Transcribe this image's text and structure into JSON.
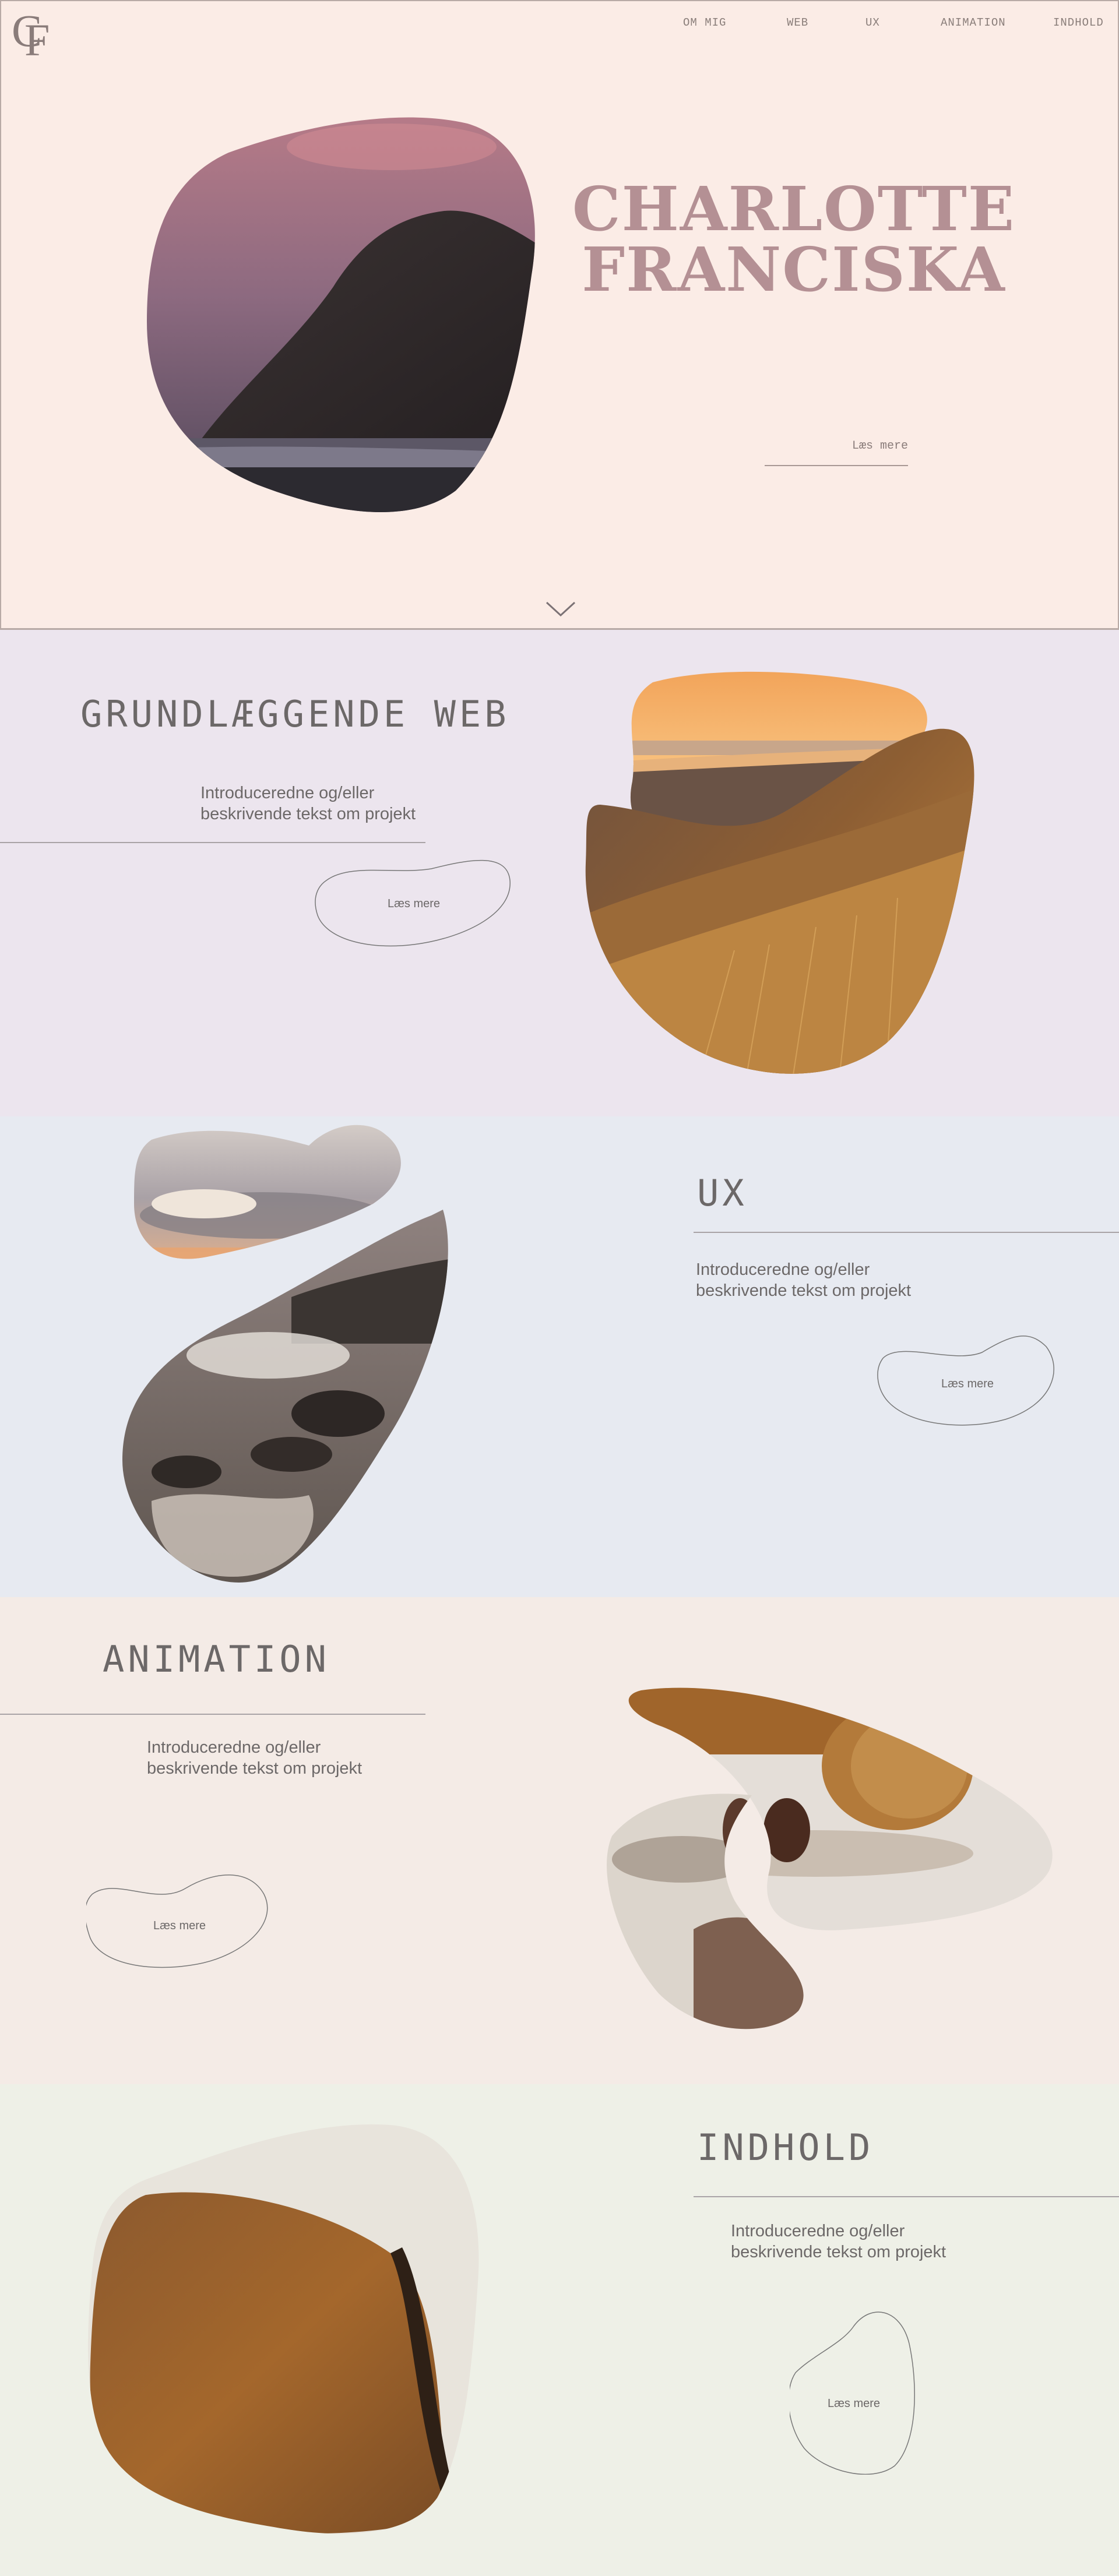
{
  "logo": {
    "letter_c": "C",
    "letter_f": "F"
  },
  "nav": {
    "items": [
      "OM MIG",
      "WEB",
      "UX",
      "ANIMATION",
      "INDHOLD"
    ]
  },
  "hero": {
    "title_line1": "CHARLOTTE",
    "title_line2": "FRANCISKA",
    "read_more": "Læs mere",
    "scroll_icon": "chevron-down-icon"
  },
  "sections": {
    "web": {
      "title": "GRUNDLÆGGENDE WEB",
      "desc_line1": "Introduceredne og/eller",
      "desc_line2": "beskrivende tekst om projekt",
      "read_more": "Læs mere"
    },
    "ux": {
      "title": "UX",
      "desc_line1": "Introduceredne og/eller",
      "desc_line2": "beskrivende tekst om projekt",
      "read_more": "Læs mere"
    },
    "animation": {
      "title": "ANIMATION",
      "desc_line1": "Introduceredne og/eller",
      "desc_line2": "beskrivende tekst om projekt",
      "read_more": "Læs mere"
    },
    "indhold": {
      "title": "INDHOLD",
      "desc_line1": "Introduceredne og/eller",
      "desc_line2": "beskrivende tekst om projekt",
      "read_more": "Læs mere"
    }
  },
  "colors": {
    "hero_bg": "#fbece6",
    "web_bg": "#ece5ee",
    "ux_bg": "#e7eaf1",
    "animation_bg": "#f4ebe6",
    "indhold_bg": "#eef0e7",
    "title_accent": "#b49094"
  }
}
